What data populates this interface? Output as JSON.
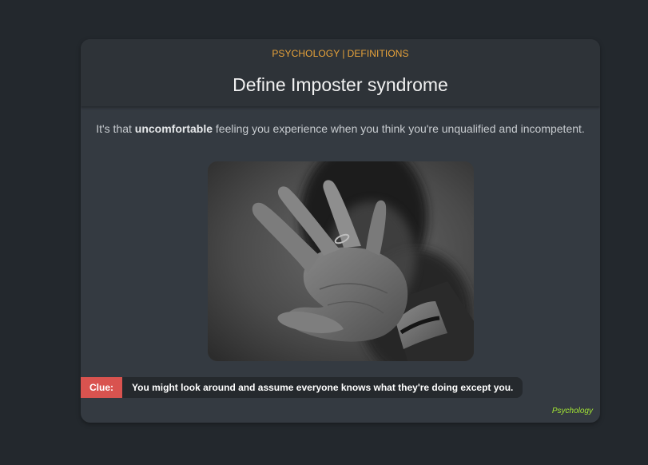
{
  "card": {
    "category": {
      "subject": "PSYCHOLOGY",
      "separator": "|",
      "type": "DEFINITIONS"
    },
    "title": "Define Imposter syndrome",
    "definition": {
      "before": "It's that ",
      "emphasis": "uncomfortable",
      "after": " feeling you experience when you think you're unqualified and incompetent."
    },
    "image": {
      "alt": "black-and-white photo of a raised open hand"
    },
    "clue": {
      "label": "Clue:",
      "text": "You might look around and assume everyone knows what they're doing except you."
    },
    "tag": "Psychology"
  },
  "colors": {
    "background": "#23282d",
    "card": "#343a41",
    "header": "#2e3338",
    "category": "#e8a33a",
    "clue_label": "#d9534f",
    "tag": "#a3e635"
  }
}
